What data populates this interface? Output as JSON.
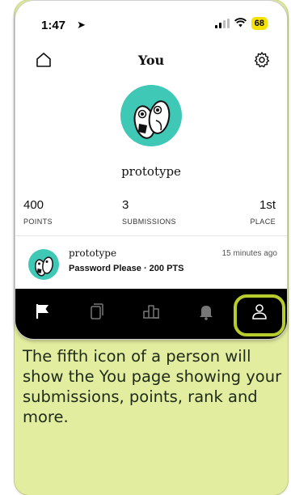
{
  "status_bar": {
    "time": "1:47",
    "battery": "68"
  },
  "header": {
    "title": "You"
  },
  "profile": {
    "username": "prototype"
  },
  "stats": [
    {
      "value": "400",
      "label": "POINTS"
    },
    {
      "value": "3",
      "label": "SUBMISSIONS"
    },
    {
      "value": "1st",
      "label": "PLACE"
    }
  ],
  "activity": {
    "username": "prototype",
    "description": "Password Please · 200 PTS",
    "time": "15 minutes ago"
  },
  "tab_bar": {
    "tabs": [
      "flag-icon",
      "cards-icon",
      "leaderboard-icon",
      "bell-icon",
      "person-icon"
    ],
    "active_highlight": "person-icon"
  },
  "caption": "The fifth icon of a person will show the You page showing your submissions, points, rank and more.",
  "colors": {
    "accent_background": "#e2ed9f",
    "highlight_ring": "#b8cc2d",
    "avatar_bg": "#3fc8b6",
    "tab_bar_bg": "#000000",
    "battery": "#f5e100"
  }
}
